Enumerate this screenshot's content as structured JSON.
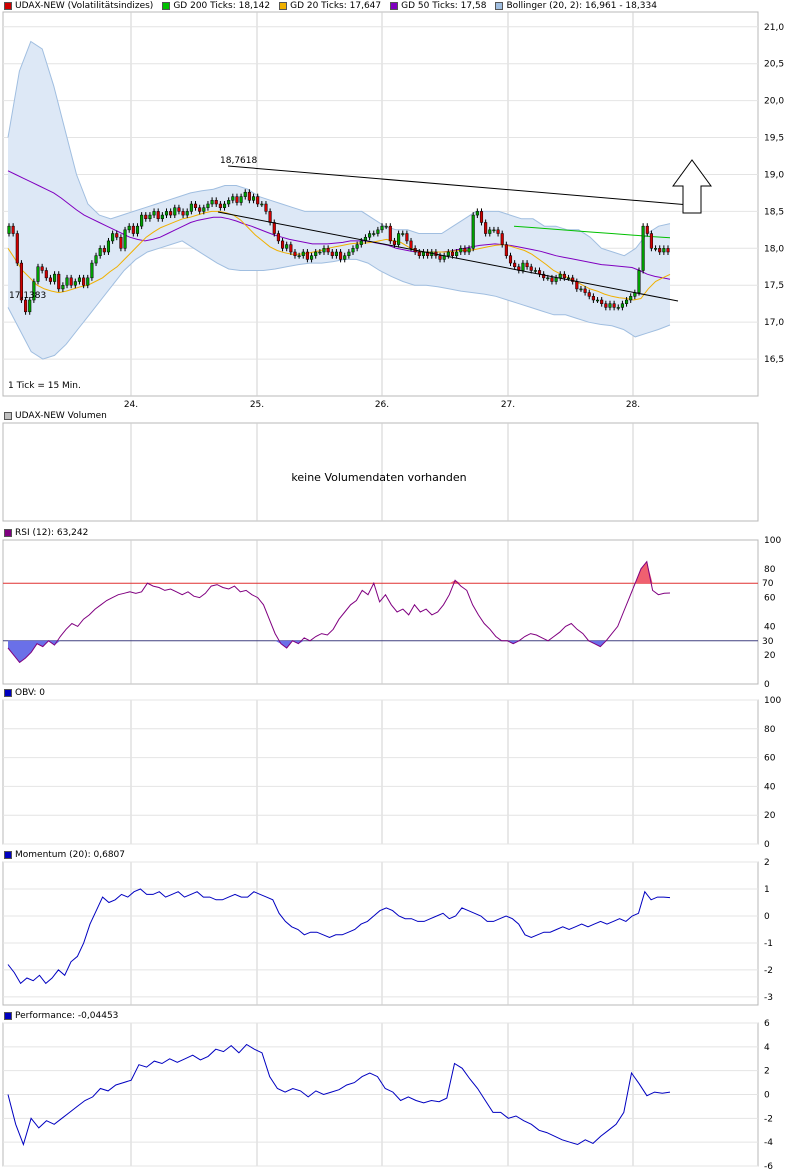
{
  "colors": {
    "gd200": "#00c000",
    "gd20": "#f0b000",
    "gd50": "#8000c0",
    "bollinger": "#a0bee0",
    "ind_line": "#0000c0",
    "rsi_line": "#800080",
    "rsi_ref": "#e03030",
    "volume_box": "#c0c0c0"
  },
  "price_panel": {
    "legend": [
      {
        "label": "UDAX-NEW (Volatilitätsindizes)",
        "color": "#d00000"
      },
      {
        "label": "GD 200 Ticks: 18,142",
        "color": "#00c000"
      },
      {
        "label": "GD 20 Ticks: 17,647",
        "color": "#f0b000"
      },
      {
        "label": "GD 50 Ticks: 17,58",
        "color": "#8000c0"
      },
      {
        "label": "Bollinger (20, 2): 16,961 - 18,334",
        "color": "#a0bee0"
      }
    ],
    "tick_note": "1 Tick = 15 Min.",
    "high_label": "18,7618",
    "low_label": "17,1383"
  },
  "volume_panel": {
    "legend": "UDAX-NEW Volumen",
    "message": "keine Volumendaten vorhanden"
  },
  "rsi_panel": {
    "legend": "RSI (12): 63,242"
  },
  "obv_panel": {
    "legend": "OBV: 0"
  },
  "momentum_panel": {
    "legend": "Momentum (20): 0,6807"
  },
  "performance_panel": {
    "legend": "Performance: -0,04453"
  },
  "chart_data": [
    {
      "type": "line",
      "panel": "price",
      "x_tick_labels": [
        "24.",
        "25.",
        "26.",
        "27.",
        "28."
      ],
      "y_tick_labels": [
        "21,0",
        "20,5",
        "20,0",
        "19,5",
        "19,0",
        "18,5",
        "18,0",
        "17,5",
        "17,0",
        "16,5"
      ],
      "ylim": [
        16.0,
        21.2
      ],
      "close": [
        18.3,
        18.2,
        17.8,
        17.3,
        17.14,
        17.3,
        17.55,
        17.75,
        17.7,
        17.6,
        17.55,
        17.65,
        17.45,
        17.5,
        17.6,
        17.5,
        17.55,
        17.6,
        17.5,
        17.6,
        17.8,
        17.9,
        18.0,
        17.95,
        18.1,
        18.2,
        18.15,
        18.0,
        18.25,
        18.3,
        18.2,
        18.3,
        18.45,
        18.4,
        18.45,
        18.5,
        18.4,
        18.45,
        18.5,
        18.45,
        18.55,
        18.5,
        18.45,
        18.5,
        18.6,
        18.55,
        18.5,
        18.55,
        18.6,
        18.65,
        18.6,
        18.55,
        18.6,
        18.65,
        18.7,
        18.62,
        18.7,
        18.76,
        18.65,
        18.7,
        18.6,
        18.6,
        18.5,
        18.35,
        18.2,
        18.1,
        18.0,
        18.05,
        17.95,
        17.9,
        17.9,
        17.95,
        17.85,
        17.9,
        17.95,
        17.95,
        18.0,
        17.95,
        17.9,
        17.95,
        17.85,
        17.9,
        17.95,
        18.0,
        18.05,
        18.1,
        18.15,
        18.2,
        18.2,
        18.25,
        18.3,
        18.3,
        18.1,
        18.05,
        18.2,
        18.2,
        18.1,
        18.0,
        17.95,
        17.9,
        17.95,
        17.9,
        17.95,
        17.9,
        17.85,
        17.9,
        17.95,
        17.9,
        17.95,
        18.0,
        17.95,
        18.0,
        18.45,
        18.5,
        18.35,
        18.2,
        18.25,
        18.25,
        18.2,
        18.05,
        17.9,
        17.8,
        17.75,
        17.7,
        17.8,
        17.75,
        17.7,
        17.7,
        17.65,
        17.6,
        17.6,
        17.55,
        17.6,
        17.65,
        17.6,
        17.6,
        17.55,
        17.45,
        17.45,
        17.4,
        17.35,
        17.3,
        17.3,
        17.25,
        17.2,
        17.25,
        17.2,
        17.2,
        17.25,
        17.3,
        17.35,
        17.4,
        17.7,
        18.3,
        18.2,
        18.0,
        18.0,
        17.95,
        18.0,
        17.95
      ],
      "gd20": [
        18.0,
        17.85,
        17.7,
        17.6,
        17.5,
        17.45,
        17.42,
        17.4,
        17.42,
        17.45,
        17.48,
        17.5,
        17.55,
        17.6,
        17.68,
        17.75,
        17.85,
        17.95,
        18.05,
        18.15,
        18.22,
        18.28,
        18.32,
        18.36,
        18.4,
        18.42,
        18.45,
        18.48,
        18.5,
        18.5,
        18.48,
        18.45,
        18.38,
        18.28,
        18.18,
        18.1,
        18.02,
        17.97,
        17.94,
        17.92,
        17.92,
        17.93,
        17.95,
        17.97,
        18.0,
        18.02,
        18.04,
        18.06,
        18.07,
        18.07,
        18.08,
        18.1,
        18.12,
        18.1,
        18.08,
        18.02,
        17.97,
        17.95,
        17.95,
        17.95,
        17.95,
        17.96,
        17.97,
        17.97,
        17.98,
        18.0,
        18.02,
        18.04,
        18.05,
        18.03,
        18.0,
        17.97,
        17.92,
        17.85,
        17.78,
        17.7,
        17.65,
        17.6,
        17.55,
        17.5,
        17.45,
        17.42,
        17.38,
        17.35,
        17.33,
        17.32,
        17.3,
        17.32,
        17.45,
        17.55,
        17.6,
        17.647
      ],
      "gd50": [
        19.05,
        19.0,
        18.95,
        18.9,
        18.85,
        18.8,
        18.75,
        18.68,
        18.6,
        18.52,
        18.45,
        18.4,
        18.35,
        18.3,
        18.25,
        18.2,
        18.15,
        18.12,
        18.1,
        18.12,
        18.15,
        18.2,
        18.25,
        18.3,
        18.35,
        18.38,
        18.4,
        18.42,
        18.42,
        18.4,
        18.37,
        18.33,
        18.3,
        18.26,
        18.22,
        18.18,
        18.15,
        18.12,
        18.1,
        18.08,
        18.06,
        18.06,
        18.06,
        18.07,
        18.08,
        18.1,
        18.1,
        18.1,
        18.08,
        18.06,
        18.04,
        18.0,
        17.98,
        17.96,
        17.95,
        17.95,
        17.95,
        17.95,
        17.96,
        17.98,
        18.0,
        18.02,
        18.04,
        18.05,
        18.06,
        18.05,
        18.04,
        18.02,
        18.0,
        17.98,
        17.96,
        17.93,
        17.9,
        17.88,
        17.86,
        17.84,
        17.82,
        17.8,
        17.78,
        17.77,
        17.76,
        17.75,
        17.74,
        17.7,
        17.65,
        17.62,
        17.6,
        17.58
      ],
      "gd200": [
        18.3,
        18.28,
        18.26,
        18.24,
        18.22,
        18.2,
        18.18,
        18.16,
        18.142
      ],
      "boll_upper": [
        19.5,
        20.4,
        20.8,
        20.7,
        20.2,
        19.6,
        19.0,
        18.6,
        18.45,
        18.4,
        18.45,
        18.5,
        18.55,
        18.6,
        18.65,
        18.7,
        18.75,
        18.78,
        18.8,
        18.85,
        18.85,
        18.8,
        18.7,
        18.65,
        18.6,
        18.55,
        18.5,
        18.5,
        18.5,
        18.5,
        18.5,
        18.5,
        18.4,
        18.3,
        18.25,
        18.25,
        18.2,
        18.2,
        18.2,
        18.3,
        18.4,
        18.5,
        18.5,
        18.5,
        18.45,
        18.4,
        18.4,
        18.3,
        18.3,
        18.25,
        18.25,
        18.15,
        18.0,
        17.95,
        17.9,
        18.0,
        18.2,
        18.3,
        18.334
      ],
      "boll_lower": [
        17.2,
        16.9,
        16.6,
        16.5,
        16.55,
        16.7,
        16.9,
        17.1,
        17.3,
        17.5,
        17.7,
        17.85,
        17.95,
        18.0,
        18.05,
        18.1,
        18.0,
        17.9,
        17.8,
        17.72,
        17.7,
        17.7,
        17.7,
        17.72,
        17.75,
        17.78,
        17.8,
        17.8,
        17.82,
        17.85,
        17.85,
        17.8,
        17.7,
        17.62,
        17.55,
        17.5,
        17.5,
        17.48,
        17.45,
        17.42,
        17.4,
        17.38,
        17.35,
        17.3,
        17.25,
        17.2,
        17.15,
        17.1,
        17.1,
        17.05,
        17.0,
        16.97,
        16.95,
        16.9,
        16.8,
        16.85,
        16.9,
        16.961
      ]
    },
    {
      "type": "line",
      "panel": "rsi",
      "y_tick_labels": [
        "100",
        "80",
        "60",
        "40",
        "20",
        "0"
      ],
      "ref_labels": [
        "70",
        "30"
      ],
      "ylim": [
        0,
        100
      ],
      "values": [
        25,
        20,
        15,
        18,
        22,
        28,
        26,
        30,
        27,
        33,
        38,
        42,
        40,
        45,
        48,
        52,
        55,
        58,
        60,
        62,
        63,
        64,
        63,
        64,
        70,
        68,
        67,
        65,
        66,
        64,
        62,
        64,
        61,
        60,
        63,
        68,
        69,
        67,
        66,
        68,
        64,
        65,
        62,
        60,
        55,
        45,
        35,
        28,
        25,
        30,
        28,
        32,
        30,
        33,
        35,
        34,
        38,
        45,
        50,
        55,
        58,
        65,
        62,
        70,
        57,
        62,
        55,
        50,
        52,
        48,
        55,
        50,
        52,
        48,
        50,
        55,
        62,
        72,
        68,
        65,
        55,
        48,
        42,
        38,
        33,
        30,
        30,
        28,
        30,
        33,
        35,
        34,
        32,
        30,
        33,
        36,
        40,
        42,
        38,
        35,
        30,
        28,
        26,
        30,
        35,
        40,
        50,
        60,
        70,
        80,
        85,
        65,
        62,
        63,
        63.2
      ]
    },
    {
      "type": "line",
      "panel": "obv",
      "y_tick_labels": [
        "100",
        "80",
        "60",
        "40",
        "20",
        "0"
      ],
      "ylim": [
        0,
        100
      ],
      "values": []
    },
    {
      "type": "line",
      "panel": "momentum",
      "y_tick_labels": [
        "2",
        "1",
        "0",
        "-1",
        "-2",
        "-3"
      ],
      "ylim": [
        -3.3,
        2
      ],
      "values": [
        -1.8,
        -2.1,
        -2.5,
        -2.3,
        -2.4,
        -2.2,
        -2.5,
        -2.3,
        -2.0,
        -2.2,
        -1.7,
        -1.5,
        -1.0,
        -0.3,
        0.2,
        0.7,
        0.5,
        0.6,
        0.8,
        0.7,
        0.9,
        1.0,
        0.8,
        0.8,
        0.9,
        0.7,
        0.8,
        0.9,
        0.7,
        0.8,
        0.9,
        0.7,
        0.7,
        0.6,
        0.6,
        0.7,
        0.8,
        0.7,
        0.7,
        0.9,
        0.8,
        0.7,
        0.6,
        0.1,
        -0.2,
        -0.4,
        -0.5,
        -0.7,
        -0.6,
        -0.6,
        -0.7,
        -0.8,
        -0.7,
        -0.7,
        -0.6,
        -0.5,
        -0.3,
        -0.2,
        0.0,
        0.2,
        0.3,
        0.2,
        0.0,
        -0.1,
        -0.1,
        -0.2,
        -0.2,
        -0.1,
        0.0,
        0.1,
        -0.1,
        0.0,
        0.3,
        0.2,
        0.1,
        0.0,
        -0.2,
        -0.2,
        -0.1,
        0.0,
        -0.1,
        -0.3,
        -0.7,
        -0.8,
        -0.7,
        -0.6,
        -0.6,
        -0.5,
        -0.4,
        -0.5,
        -0.4,
        -0.3,
        -0.4,
        -0.3,
        -0.2,
        -0.3,
        -0.2,
        -0.1,
        -0.2,
        0.0,
        0.1,
        0.9,
        0.6,
        0.7,
        0.7,
        0.6807
      ]
    },
    {
      "type": "line",
      "panel": "performance",
      "y_tick_labels": [
        "6",
        "4",
        "2",
        "0",
        "-2",
        "-4",
        "-6"
      ],
      "ylim": [
        -6,
        6
      ],
      "values": [
        0.0,
        -2.5,
        -4.2,
        -2.0,
        -2.8,
        -2.2,
        -2.5,
        -2.0,
        -1.5,
        -1.0,
        -0.5,
        -0.2,
        0.5,
        0.3,
        0.8,
        1.0,
        1.2,
        2.5,
        2.3,
        2.8,
        2.6,
        3.0,
        2.7,
        3.0,
        3.3,
        2.9,
        3.2,
        3.8,
        3.6,
        4.1,
        3.5,
        4.2,
        3.8,
        3.5,
        1.5,
        0.5,
        0.2,
        0.5,
        0.3,
        -0.2,
        0.3,
        0.0,
        0.2,
        0.4,
        0.8,
        1.0,
        1.5,
        1.8,
        1.5,
        0.5,
        0.2,
        -0.5,
        -0.2,
        -0.5,
        -0.7,
        -0.5,
        -0.6,
        -0.3,
        2.6,
        2.2,
        1.3,
        0.5,
        -0.5,
        -1.5,
        -1.5,
        -2.0,
        -1.8,
        -2.2,
        -2.5,
        -3.0,
        -3.2,
        -3.5,
        -3.8,
        -4.0,
        -4.2,
        -3.8,
        -4.1,
        -3.5,
        -3.0,
        -2.5,
        -1.5,
        1.8,
        0.9,
        -0.1,
        0.2,
        0.1,
        0.2
      ]
    }
  ]
}
